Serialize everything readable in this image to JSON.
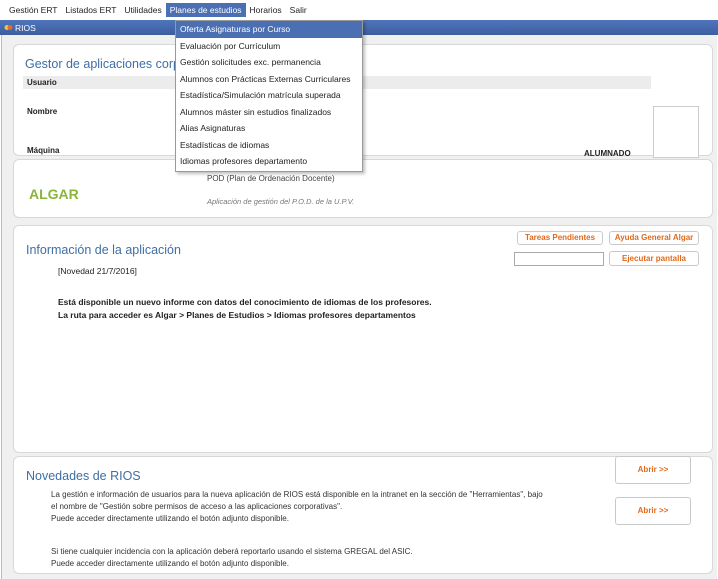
{
  "menubar": {
    "items": [
      "Gestión ERT",
      "Listados ERT",
      "Utilidades",
      "Planes de estudios",
      "Horarios",
      "Salir"
    ]
  },
  "window": {
    "title": "RIOS"
  },
  "user_panel": {
    "title": "Gestor de aplicaciones corp",
    "usuario_label": "Usuario",
    "nombre_label": "Nombre",
    "maquina_label": "Máquina",
    "group": "ALUMNADO"
  },
  "algar_panel": {
    "name": "ALGAR",
    "pod": "POD (Plan de Ordenación Docente)",
    "subtitle": "Aplicación de gestión del P.O.D. de la U.P.V."
  },
  "info_panel": {
    "title": "Información de la aplicación",
    "buttons": {
      "tareas": "Tareas Pendientes",
      "ayuda": "Ayuda General Algar",
      "ejecutar": "Ejecutar pantalla"
    },
    "search_value": "",
    "novedad": "[Novedad 21/7/2016]",
    "line1": "Está disponible un nuevo informe con datos del conocimiento de idiomas de los profesores.",
    "line2": "La ruta para acceder es Algar > Planes de Estudios > Idiomas profesores departamentos"
  },
  "news_panel": {
    "title": "Novedades de RIOS",
    "p1_line1": "La gestión e información de usuarios para la nueva aplicación de RIOS está disponible en la intranet en la sección de \"Herramientas\", bajo",
    "p1_line2": "el nombre de \"Gestión sobre permisos de acceso a las aplicaciones corporativas\".",
    "p1_line3": "Puede acceder directamente utilizando el botón adjunto disponible.",
    "p2_line1": "Si tiene cualquier incidencia con la aplicación deberá reportarlo usando el sistema GREGAL del ASIC.",
    "p2_line2": "Puede acceder directamente utilizando el botón adjunto disponible.",
    "open_label": "Abrir >>"
  },
  "dropdown": {
    "items": [
      "Oferta Asignaturas por Curso",
      "Evaluación por Currículum",
      "Gestión solicitudes exc. permanencia",
      "Alumnos con Prácticas Externas Curriculares",
      "Estadística/Simulación matrícula superada",
      "Alumnos máster sin estudios finalizados",
      "Alias Asignaturas",
      "Estadísticas de idiomas",
      "Idiomas profesores departamento"
    ],
    "selected_index": 0
  },
  "colors": {
    "accent": "#4a6fb3",
    "heading": "#3f6ea6",
    "algar": "#8ab53a",
    "button_text": "#e06a1c"
  }
}
